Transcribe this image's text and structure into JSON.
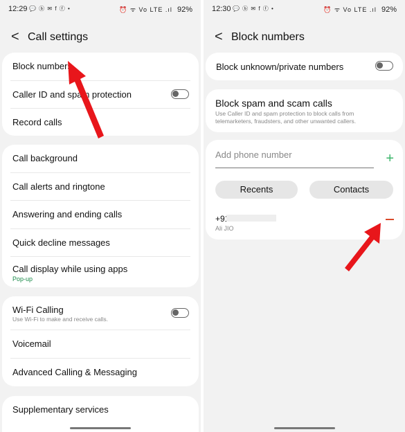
{
  "left": {
    "status": {
      "time": "12:29",
      "icons": "💬 ⓑ ✉ f ⓕ •",
      "signal": "⏰ ᯤ Vo LTE .ıl",
      "battery": "92%"
    },
    "header": {
      "back": "<",
      "title": "Call settings"
    },
    "card1": [
      {
        "label": "Block numbers"
      },
      {
        "label": "Caller ID and spam protection",
        "toggle": "off"
      },
      {
        "label": "Record calls"
      }
    ],
    "card2": [
      {
        "label": "Call background"
      },
      {
        "label": "Call alerts and ringtone"
      },
      {
        "label": "Answering and ending calls"
      },
      {
        "label": "Quick decline messages"
      },
      {
        "label": "Call display while using apps",
        "sub": "Pop-up"
      }
    ],
    "card3": [
      {
        "label": "Wi-Fi Calling",
        "sub": "Use Wi-Fi to make and receive calls.",
        "toggle": "off"
      },
      {
        "label": "Voicemail"
      },
      {
        "label": "Advanced Calling & Messaging"
      }
    ],
    "card4": [
      {
        "label": "Supplementary services"
      }
    ]
  },
  "right": {
    "status": {
      "time": "12:30",
      "icons": "💬 ⓑ ✉ f ⓕ •",
      "signal": "⏰ ᯤ Vo LTE .ıl",
      "battery": "92%"
    },
    "header": {
      "back": "<",
      "title": "Block numbers"
    },
    "block_unknown": {
      "label": "Block unknown/private numbers",
      "toggle": "off"
    },
    "spam": {
      "title": "Block spam and scam calls",
      "description": "Use Caller ID and spam protection to block calls from telemarketers, fraudsters, and other unwanted callers."
    },
    "add": {
      "placeholder": "Add phone number",
      "plus": "+"
    },
    "buttons": {
      "recents": "Recents",
      "contacts": "Contacts"
    },
    "blocked": {
      "number": "+91",
      "name": "Ali JIO"
    }
  },
  "colors": {
    "arrow": "#e8161b",
    "accent_green": "#1a8a4a",
    "remove_red": "#d94a2a"
  }
}
